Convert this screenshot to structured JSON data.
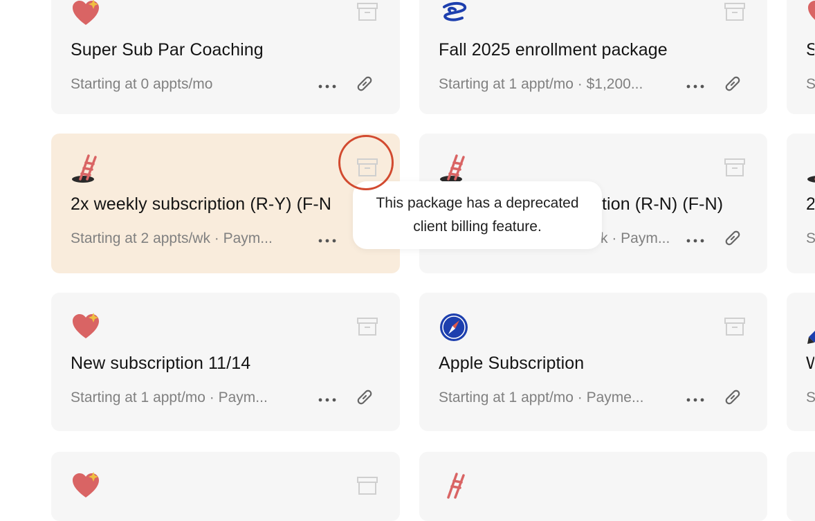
{
  "cards": [
    {
      "id": "c1",
      "icon": "heart-icon",
      "title": "Super Sub Par Coaching",
      "subtitle": "Starting at 0 appts/mo"
    },
    {
      "id": "c2",
      "icon": "spiral-icon",
      "title": "Fall 2025 enrollment package",
      "subtitle": "Starting at 1 appt/mo · $1,200..."
    },
    {
      "id": "c3",
      "icon": "heart-icon",
      "title": "S",
      "subtitle": "S"
    },
    {
      "id": "c4",
      "icon": "ladder-icon",
      "title": "2x weekly subscription (R-Y) (F-N",
      "subtitle": "Starting at 2 appts/wk · Paym..."
    },
    {
      "id": "c5",
      "icon": "ladder-icon",
      "title": "tion (R-N) (F-N)",
      "subtitle": "k · Paym..."
    },
    {
      "id": "c6",
      "icon": "ladder-icon",
      "title": "2",
      "subtitle": "S"
    },
    {
      "id": "c7",
      "icon": "heart-icon",
      "title": "New subscription 11/14",
      "subtitle": "Starting at 1 appt/mo · Paym..."
    },
    {
      "id": "c8",
      "icon": "compass-icon",
      "title": "Apple Subscription",
      "subtitle": "Starting at 1 appt/mo · Payme..."
    },
    {
      "id": "c9",
      "icon": "pencil-icon",
      "title": "W",
      "subtitle": "S"
    }
  ],
  "tooltip": {
    "text_line1": "This package has a deprecated",
    "text_line2": "client billing feature."
  },
  "colors": {
    "card_bg": "#f6f6f6",
    "highlighted_card_bg": "#f9ecdc",
    "annotation_circle": "#d24a2f"
  }
}
